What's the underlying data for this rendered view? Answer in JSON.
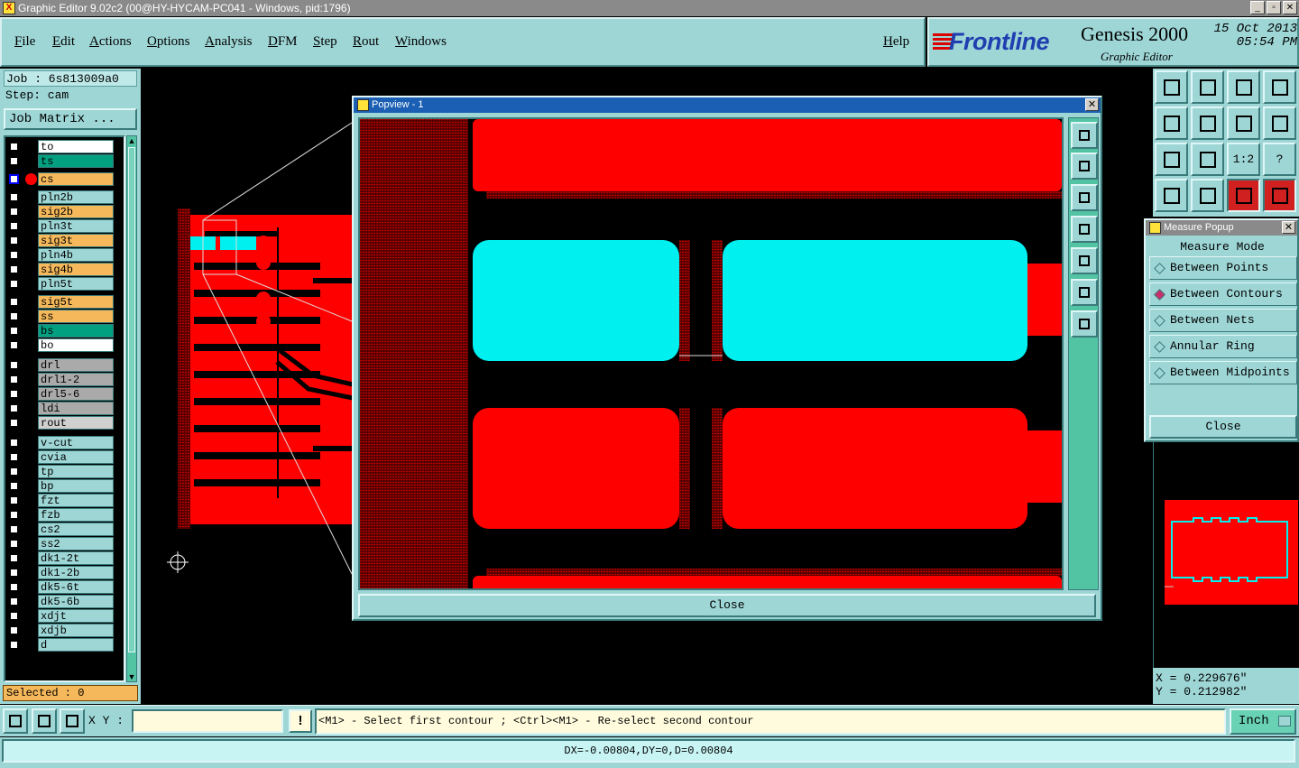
{
  "window": {
    "title": "Graphic Editor 9.02c2 (00@HY-HYCAM-PC041 - Windows, pid:1796)",
    "controls": [
      "_",
      "▫",
      "✕"
    ]
  },
  "menu": [
    {
      "label": "File"
    },
    {
      "label": "Edit"
    },
    {
      "label": "Actions"
    },
    {
      "label": "Options"
    },
    {
      "label": "Analysis"
    },
    {
      "label": "DFM"
    },
    {
      "label": "Step"
    },
    {
      "label": "Rout"
    },
    {
      "label": "Windows"
    },
    {
      "label": "Help"
    }
  ],
  "brand": {
    "logo": "Frontline",
    "product": "Genesis 2000",
    "subtitle": "Graphic Editor",
    "date": "15 Oct 2013",
    "time": "05:54 PM"
  },
  "job": {
    "job_line": "Job : 6s813009a0",
    "step_line": "Step: cam",
    "matrix_button": "Job Matrix ..."
  },
  "layers": [
    {
      "name": "to",
      "color": "white"
    },
    {
      "name": "ts",
      "color": "green"
    },
    {
      "name": "cs",
      "color": "orange",
      "active": true
    },
    {
      "name": "pln2b",
      "color": "cyan"
    },
    {
      "name": "sig2b",
      "color": "orange"
    },
    {
      "name": "pln3t",
      "color": "cyan"
    },
    {
      "name": "sig3t",
      "color": "orange"
    },
    {
      "name": "pln4b",
      "color": "cyan"
    },
    {
      "name": "sig4b",
      "color": "orange"
    },
    {
      "name": "pln5t",
      "color": "cyan"
    },
    {
      "name": "sig5t",
      "color": "orange"
    },
    {
      "name": "ss",
      "color": "orange"
    },
    {
      "name": "bs",
      "color": "green"
    },
    {
      "name": "bo",
      "color": "white"
    },
    {
      "name": "drl",
      "color": "grey"
    },
    {
      "name": "drl1-2",
      "color": "grey"
    },
    {
      "name": "drl5-6",
      "color": "grey"
    },
    {
      "name": "ldi",
      "color": "grey"
    },
    {
      "name": "rout",
      "color": "lgrey"
    },
    {
      "name": "v-cut",
      "color": "cyan"
    },
    {
      "name": "cvia",
      "color": "cyan"
    },
    {
      "name": "tp",
      "color": "cyan"
    },
    {
      "name": "bp",
      "color": "cyan"
    },
    {
      "name": "fzt",
      "color": "cyan"
    },
    {
      "name": "fzb",
      "color": "cyan"
    },
    {
      "name": "cs2",
      "color": "cyan"
    },
    {
      "name": "ss2",
      "color": "cyan"
    },
    {
      "name": "dk1-2t",
      "color": "cyan"
    },
    {
      "name": "dk1-2b",
      "color": "cyan"
    },
    {
      "name": "dk5-6t",
      "color": "cyan"
    },
    {
      "name": "dk5-6b",
      "color": "cyan"
    },
    {
      "name": "xdjt",
      "color": "cyan"
    },
    {
      "name": "xdjb",
      "color": "cyan"
    },
    {
      "name": "d",
      "color": "cyan"
    }
  ],
  "selected": "Selected : 0",
  "popview": {
    "title": "Popview - 1",
    "close_label": "Close"
  },
  "measure": {
    "title": "Measure Popup",
    "mode_label": "Measure Mode",
    "options": [
      {
        "label": "Between Points",
        "selected": false
      },
      {
        "label": "Between Contours",
        "selected": true
      },
      {
        "label": "Between Nets",
        "selected": false
      },
      {
        "label": "Annular Ring",
        "selected": false
      },
      {
        "label": "Between Midpoints",
        "selected": false
      }
    ],
    "close_label": "Close"
  },
  "right_tools": {
    "ratio_label": "1:2",
    "help_label": "?"
  },
  "coords": {
    "x": "X = 0.229676\"",
    "y": "Y = 0.212982\""
  },
  "bottom": {
    "xy_label": "X Y :",
    "xy_value": "",
    "warn_label": "!",
    "prompt": "<M1> - Select first contour ; <Ctrl><M1> - Re-select second contour",
    "unit": "Inch"
  },
  "status": "DX=-0.00804,DY=0,D=0.00804",
  "colors": {
    "panel": "#9ed6d6",
    "copper": "#ff0000",
    "highlight": "#00f0f0",
    "background": "#000000"
  }
}
